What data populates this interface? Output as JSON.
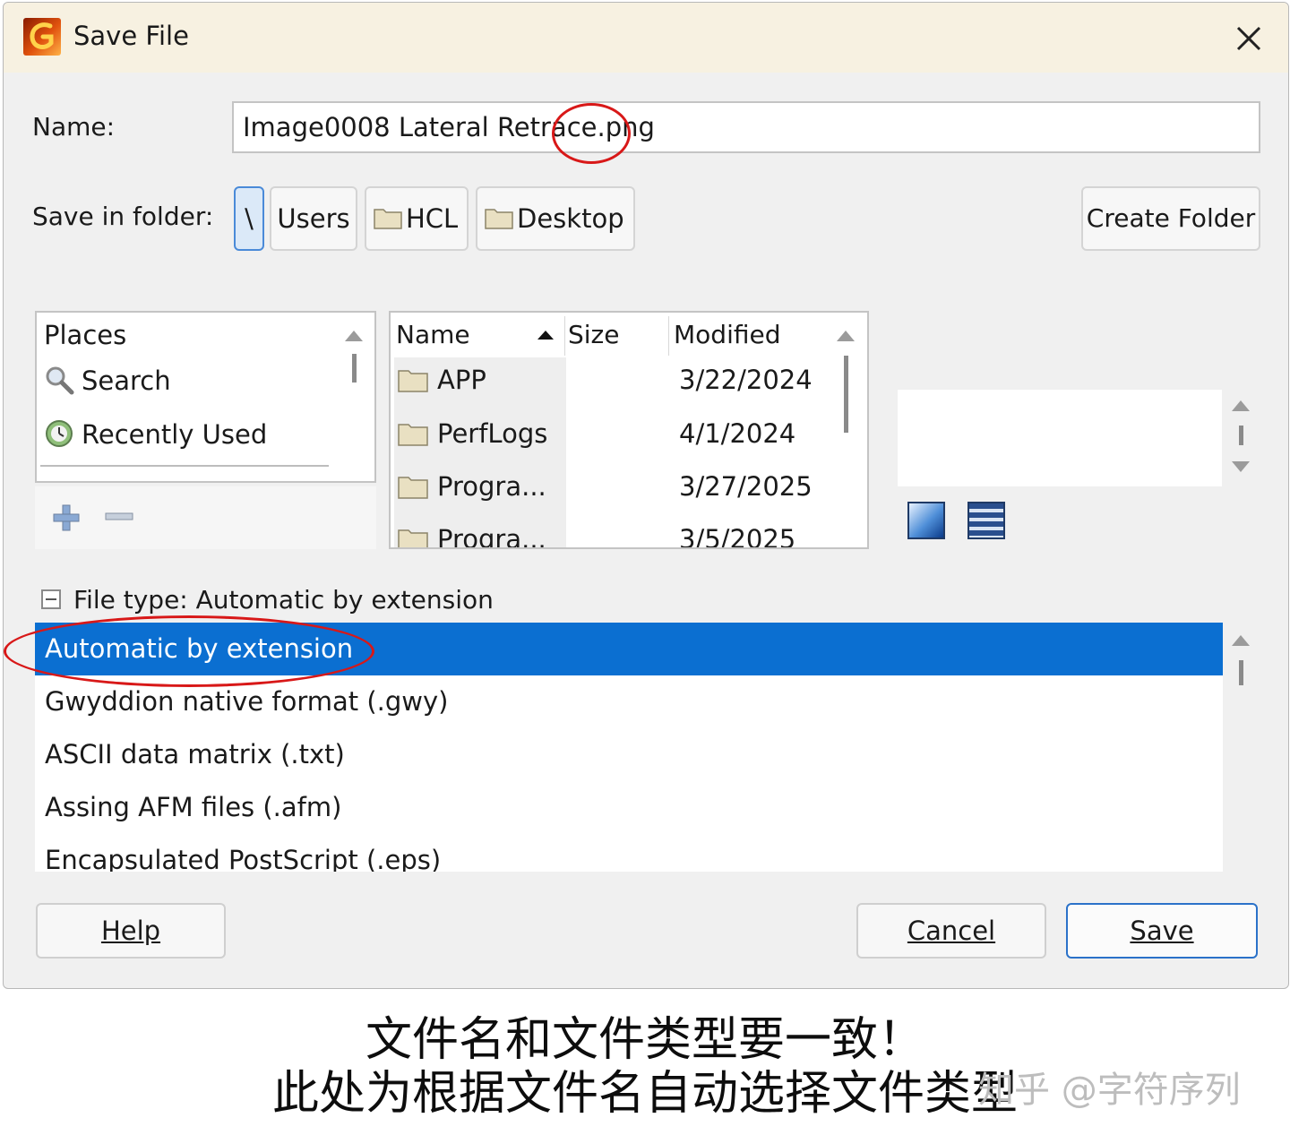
{
  "window": {
    "title": "Save File",
    "app_icon": "gwyddion-icon",
    "close_icon": "close-icon"
  },
  "name_field": {
    "label": "Name:",
    "value": "Image0008 Lateral Retrace.png"
  },
  "folder": {
    "label": "Save in folder:",
    "crumbs": [
      "\\",
      "Users",
      "HCL",
      "Desktop"
    ],
    "create_folder_label": "Create Folder"
  },
  "places": {
    "header": "Places",
    "items": [
      {
        "label": "Search",
        "icon": "search-icon"
      },
      {
        "label": "Recently Used",
        "icon": "recent-icon"
      }
    ],
    "add_icon": "add-icon",
    "remove_icon": "remove-icon"
  },
  "files": {
    "columns": [
      "Name",
      "Size",
      "Modified"
    ],
    "sort_icon": "sort-ascending-icon",
    "rows": [
      {
        "name": "APP",
        "size": "",
        "modified": "3/22/2024"
      },
      {
        "name": "PerfLogs",
        "size": "",
        "modified": "4/1/2024"
      },
      {
        "name": "Progra...",
        "size": "",
        "modified": "3/27/2025"
      },
      {
        "name": "Progra...",
        "size": "",
        "modified": "3/5/2025"
      }
    ]
  },
  "preview": {
    "gradient_icon": "gradient-preview-icon",
    "lines_icon": "lines-preview-icon"
  },
  "file_type": {
    "header": "File type: Automatic by extension",
    "options": [
      "Automatic by extension",
      "Gwyddion native format (.gwy)",
      "ASCII data matrix (.txt)",
      "Assing AFM files (.afm)",
      "Encapsulated PostScript (.eps)"
    ],
    "selected_index": 0
  },
  "buttons": {
    "help": "Help",
    "cancel": "Cancel",
    "save": "Save"
  },
  "colors": {
    "selection": "#0b6fd1",
    "annotation": "#d81818",
    "titlebar": "#f7f1e1"
  },
  "caption": {
    "line1": "文件名和文件类型要一致！",
    "line2": "此处为根据文件名自动选择文件类型",
    "watermark": "知乎 @字符序列"
  }
}
